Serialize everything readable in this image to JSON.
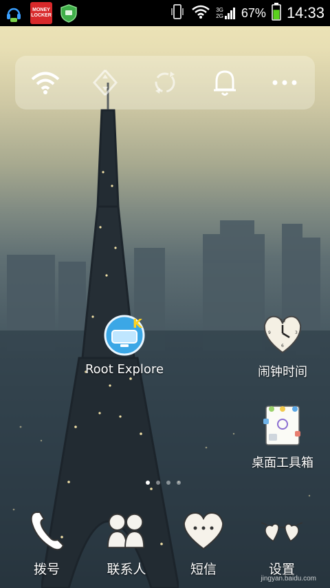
{
  "status_bar": {
    "left_icons": [
      "headset-chat-icon",
      "money-locker-icon",
      "shield-icon"
    ],
    "money_locker_text": "MONEY LOCKER",
    "network_labels": [
      "3G",
      "2G"
    ],
    "battery_percent": "67%",
    "battery_level": 0.67,
    "time": "14:33"
  },
  "quick_settings": [
    "wifi-icon",
    "data-sync-icon",
    "auto-rotate-icon",
    "bell-icon",
    "more-icon"
  ],
  "desktop": {
    "root_explorer_label": "Root Explore",
    "alarm_label": "闹钟时间",
    "toolbox_label": "桌面工具箱"
  },
  "page_dots": {
    "count": 4,
    "active": 0
  },
  "dock": {
    "dial_label": "拨号",
    "contacts_label": "联系人",
    "sms_label": "短信",
    "settings_label": "设置"
  },
  "watermark": "jingyan.baidu.com"
}
